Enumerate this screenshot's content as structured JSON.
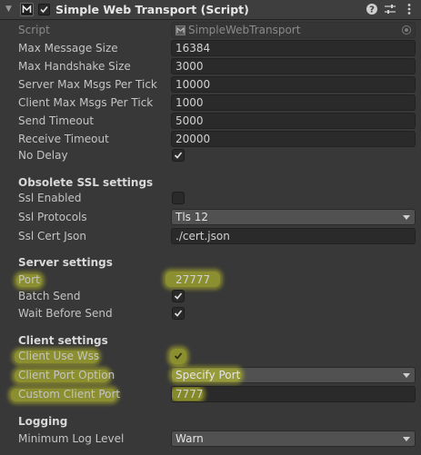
{
  "header": {
    "title": "Simple Web Transport (Script)",
    "help_icon": "help-icon",
    "preset_icon": "sliders-icon",
    "menu_icon": "kebab-menu-icon"
  },
  "fields": {
    "script": {
      "label": "Script",
      "value": "SimpleWebTransport"
    },
    "max_message_size": {
      "label": "Max Message Size",
      "value": "16384"
    },
    "max_handshake_size": {
      "label": "Max Handshake Size",
      "value": "3000"
    },
    "server_max_msgs": {
      "label": "Server Max Msgs Per Tick",
      "value": "10000"
    },
    "client_max_msgs": {
      "label": "Client Max Msgs Per Tick",
      "value": "1000"
    },
    "send_timeout": {
      "label": "Send Timeout",
      "value": "5000"
    },
    "receive_timeout": {
      "label": "Receive Timeout",
      "value": "20000"
    },
    "no_delay": {
      "label": "No Delay",
      "checked": true
    }
  },
  "ssl": {
    "heading": "Obsolete SSL settings",
    "ssl_enabled": {
      "label": "Ssl Enabled",
      "checked": false
    },
    "ssl_protocols": {
      "label": "Ssl Protocols",
      "value": "Tls 12"
    },
    "ssl_cert_json": {
      "label": "Ssl Cert Json",
      "value": "./cert.json"
    }
  },
  "server": {
    "heading": "Server settings",
    "port": {
      "label": "Port",
      "value": "27777"
    },
    "batch_send": {
      "label": "Batch Send",
      "checked": true
    },
    "wait_before_send": {
      "label": "Wait Before Send",
      "checked": true
    }
  },
  "client": {
    "heading": "Client settings",
    "client_use_wss": {
      "label": "Client Use Wss",
      "checked": true
    },
    "client_port_option": {
      "label": "Client Port Option",
      "value": "Specify Port"
    },
    "custom_client_port": {
      "label": "Custom Client Port",
      "value": "7777"
    }
  },
  "logging": {
    "heading": "Logging",
    "minimum_log_level": {
      "label": "Minimum Log Level",
      "value": "Warn"
    }
  },
  "colors": {
    "highlight": "#d2d728",
    "background": "#383838"
  }
}
